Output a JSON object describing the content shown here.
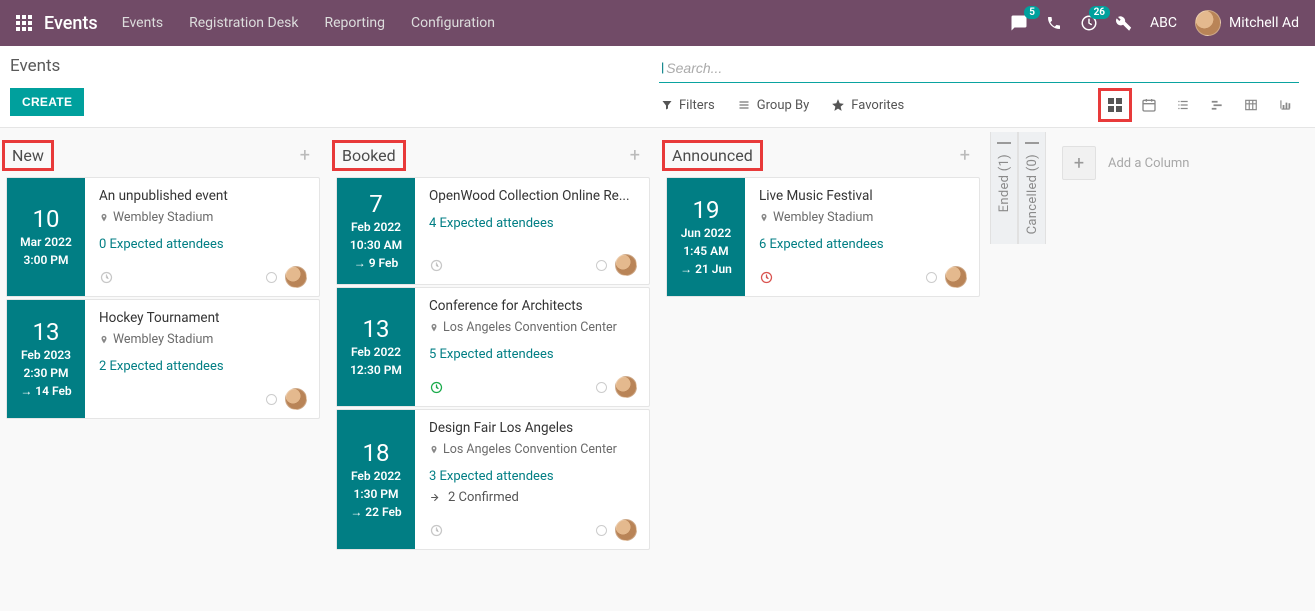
{
  "brand": "Events",
  "top_menu": [
    "Events",
    "Registration Desk",
    "Reporting",
    "Configuration"
  ],
  "msg_badge": "5",
  "clock_badge": "26",
  "company": "ABC",
  "user_name": "Mitchell Ad",
  "breadcrumb": "Events",
  "create_btn": "CREATE",
  "search": {
    "placeholder": "Search..."
  },
  "filters": {
    "filters": "Filters",
    "groupby": "Group By",
    "favorites": "Favorites"
  },
  "add_column": "Add a Column",
  "folded": [
    {
      "label": "Ended (1)"
    },
    {
      "label": "Cancelled (0)"
    }
  ],
  "columns": [
    {
      "title": "New",
      "cards": [
        {
          "day": "10",
          "mon": "Mar 2022",
          "time": "3:00 PM",
          "end": "",
          "title": "An unpublished event",
          "loc": "Wembley Stadium",
          "attendees": "0 Expected attendees",
          "confirmed": "",
          "clock": "grey",
          "avatar": true
        },
        {
          "day": "13",
          "mon": "Feb 2023",
          "time": "2:30 PM",
          "end": "14 Feb",
          "title": "Hockey Tournament",
          "loc": "Wembley Stadium",
          "attendees": "2 Expected attendees",
          "confirmed": "",
          "clock": "",
          "avatar": true
        }
      ]
    },
    {
      "title": "Booked",
      "cards": [
        {
          "day": "7",
          "mon": "Feb 2022",
          "time": "10:30 AM",
          "end": "9 Feb",
          "title": "OpenWood Collection Online Re...",
          "loc": "",
          "attendees": "4 Expected attendees",
          "confirmed": "",
          "clock": "grey",
          "avatar": true
        },
        {
          "day": "13",
          "mon": "Feb 2022",
          "time": "12:30 PM",
          "end": "",
          "title": "Conference for Architects",
          "loc": "Los Angeles Convention Center",
          "attendees": "5 Expected attendees",
          "confirmed": "",
          "clock": "green",
          "avatar": true
        },
        {
          "day": "18",
          "mon": "Feb 2022",
          "time": "1:30 PM",
          "end": "22 Feb",
          "title": "Design Fair Los Angeles",
          "loc": "Los Angeles Convention Center",
          "attendees": "3 Expected attendees",
          "confirmed": "2 Confirmed",
          "clock": "grey",
          "avatar": true
        }
      ]
    },
    {
      "title": "Announced",
      "cards": [
        {
          "day": "19",
          "mon": "Jun 2022",
          "time": "1:45 AM",
          "end": "21 Jun",
          "title": "Live Music Festival",
          "loc": "Wembley Stadium",
          "attendees": "6 Expected attendees",
          "confirmed": "",
          "clock": "red",
          "avatar": true
        }
      ]
    }
  ]
}
